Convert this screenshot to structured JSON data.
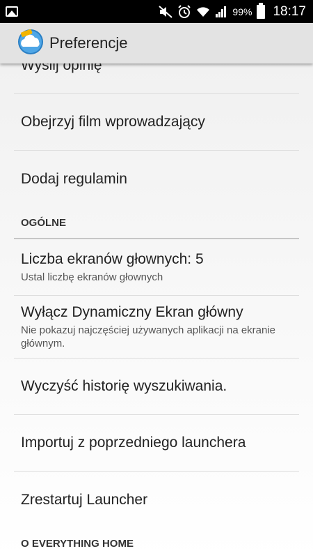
{
  "status_bar": {
    "battery": "99%",
    "time": "18:17",
    "icons": [
      "gallery-icon",
      "mute-icon",
      "alarm-icon",
      "wifi-icon",
      "signal-icon",
      "battery-icon"
    ]
  },
  "action_bar": {
    "title": "Preferencje",
    "logo_icon": "everything-home-cloud-icon"
  },
  "items": {
    "feedback": "Wyślij opinię",
    "watch_intro": "Obejrzyj film wprowadzający",
    "add_terms": "Dodaj regulamin",
    "category_general": "OGÓLNE",
    "home_screens_title": "Liczba ekranów głownych: 5",
    "home_screens_summary": "Ustal liczbę ekranów głownych",
    "dynamic_title": "Wyłącz Dynamiczny Ekran główny",
    "dynamic_summary": "Nie pokazuj najczęściej używanych aplikacji na ekranie głównym.",
    "clear_history": "Wyczyść historię wyszukiwania.",
    "import_launcher": "Importuj z poprzedniego launchera",
    "restart_launcher": "Zrestartuj Launcher",
    "category_about": "O EVERYTHING HOME"
  },
  "colors": {
    "status_bar": "#000000",
    "action_bar": "#e3e3e3",
    "text": "#222222",
    "divider": "#dcdcdc"
  }
}
